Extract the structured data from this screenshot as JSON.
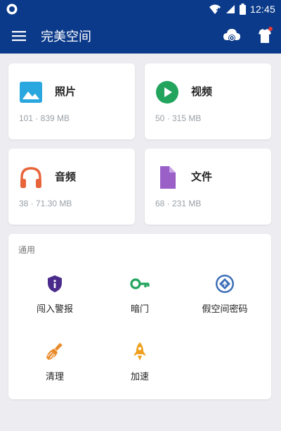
{
  "statusbar": {
    "time": "12:45"
  },
  "appbar": {
    "title": "完美空间"
  },
  "categories": [
    {
      "name": "照片",
      "stat": "101 · 839 MB",
      "icon": "image-icon",
      "color": "#2aa7df"
    },
    {
      "name": "视频",
      "stat": "50 · 315 MB",
      "icon": "play-icon",
      "color": "#22a45d"
    },
    {
      "name": "音频",
      "stat": "38 · 71.30 MB",
      "icon": "headphones-icon",
      "color": "#e8643a"
    },
    {
      "name": "文件",
      "stat": "68 · 231 MB",
      "icon": "document-icon",
      "color": "#9b5fc8"
    }
  ],
  "general": {
    "title": "通用",
    "items": [
      {
        "label": "闯入警报",
        "icon": "shield-icon",
        "color": "#4a2a8a"
      },
      {
        "label": "暗门",
        "icon": "key-icon",
        "color": "#22a45d"
      },
      {
        "label": "假空间密码",
        "icon": "fake-space-icon",
        "color": "#3d6fb8"
      },
      {
        "label": "清理",
        "icon": "broom-icon",
        "color": "#e88b2a"
      },
      {
        "label": "加速",
        "icon": "rocket-icon",
        "color": "#f0a020"
      }
    ]
  }
}
